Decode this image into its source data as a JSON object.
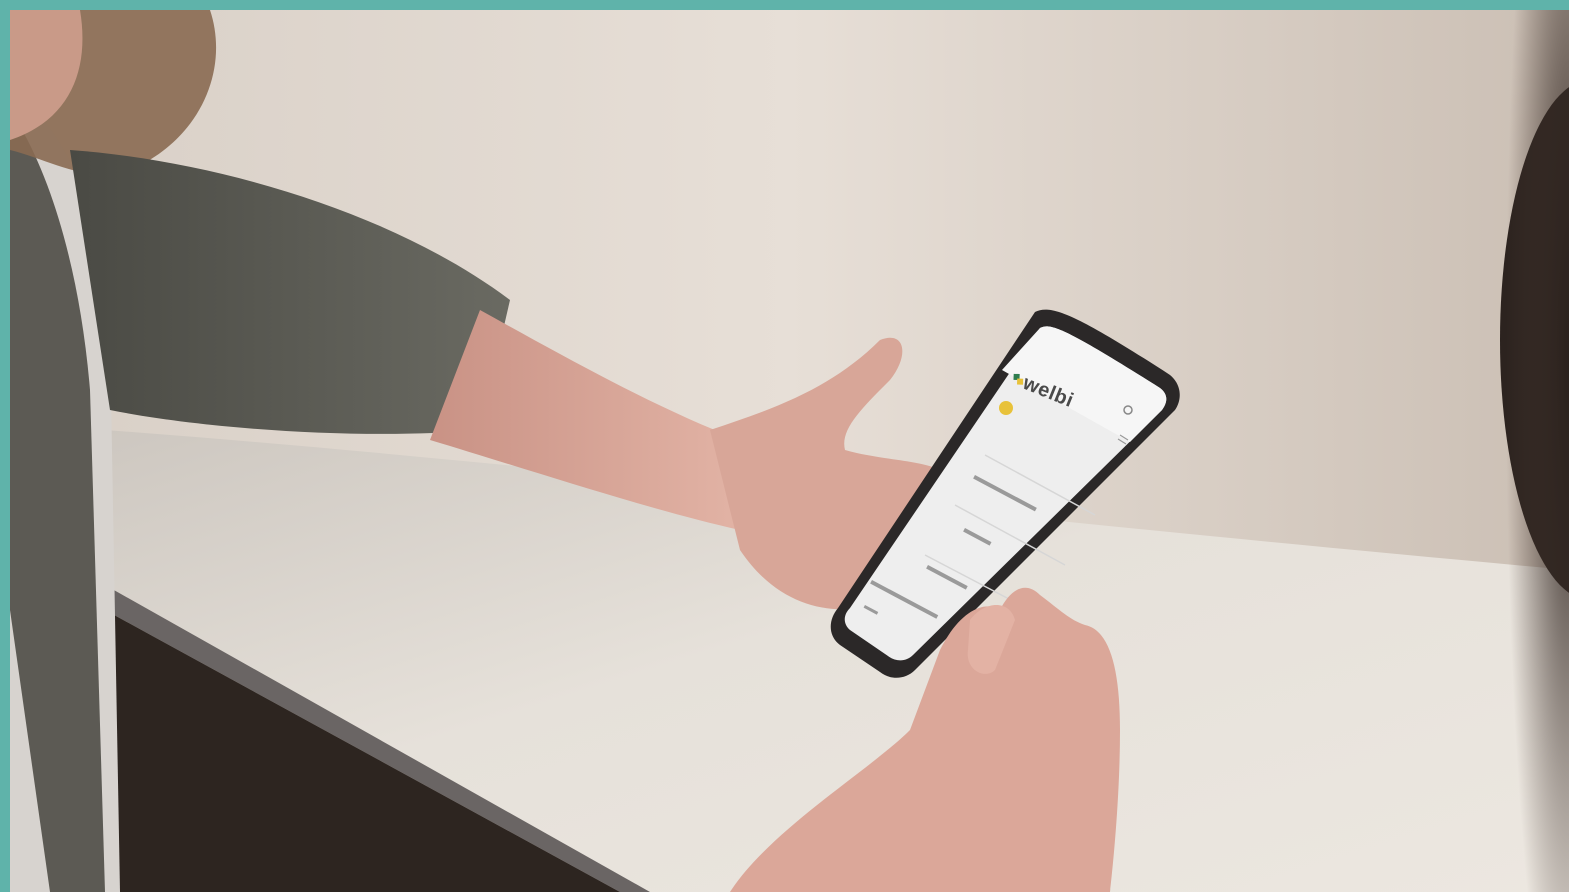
{
  "scene": {
    "description_label": "",
    "colors": {
      "frame": "#5fb3aa",
      "wall": "#ddd3c9",
      "table": "#e9e4dd",
      "sleeve": "#5f5f58",
      "skin": "#d9a99a",
      "phone_body": "#2c2a2a",
      "screen": "#f2f2f2",
      "logo_green": "#2e7d4f",
      "logo_yellow": "#e8c23a"
    }
  },
  "phone_app": {
    "logo": "welbi",
    "icons": [
      "welbi-logo-icon",
      "avatar-icon",
      "settings-icon",
      "menu-icon"
    ]
  }
}
